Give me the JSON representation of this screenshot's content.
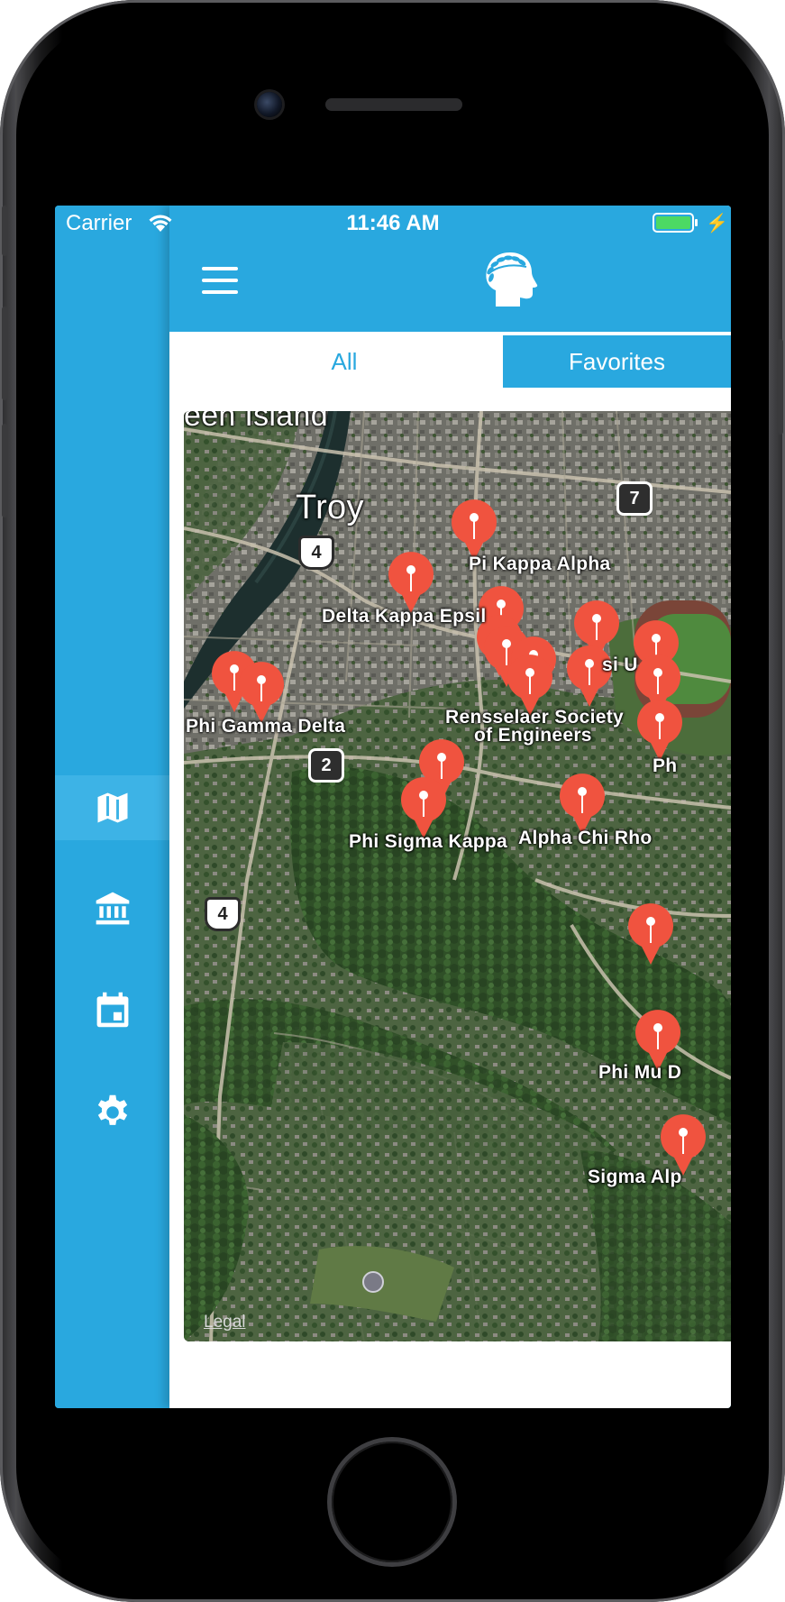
{
  "status_bar": {
    "carrier": "Carrier",
    "time": "11:46 AM",
    "battery_level": 1.0,
    "battery_color": "#4cd964"
  },
  "theme": {
    "accent": "#29a8df",
    "pin": "#f0533f"
  },
  "side_menu": {
    "items": [
      {
        "icon": "map-icon",
        "active": true
      },
      {
        "icon": "institution-icon",
        "active": false
      },
      {
        "icon": "calendar-icon",
        "active": false
      },
      {
        "icon": "gear-icon",
        "active": false
      }
    ]
  },
  "navbar": {
    "menu_icon": "hamburger-icon",
    "logo_icon": "laurel-head-logo"
  },
  "tabs": {
    "all": "All",
    "favorites": "Favorites"
  },
  "map": {
    "place_labels": {
      "green_island": "een Island",
      "troy": "Troy"
    },
    "pin_labels": {
      "pi_kappa_alpha": "Pi Kappa Alpha",
      "delta_kappa_epsilon": "Delta Kappa Epsil",
      "phi_gamma_delta": "Phi Gamma Delta",
      "rensselaer_1": "Rensselaer Society",
      "rensselaer_2": "of Engineers",
      "phi_sigma_kappa": "Phi Sigma Kappa",
      "alpha_chi_rho": "Alpha Chi Rho",
      "psi_u": "si U",
      "ph": "Ph",
      "phi_mu": "Phi Mu D",
      "sigma_al": "Sigma Alp"
    },
    "routes": {
      "us4_top": "4",
      "us4_bottom": "4",
      "ny7": "7",
      "ny2": "2"
    },
    "legal": "Legal"
  }
}
